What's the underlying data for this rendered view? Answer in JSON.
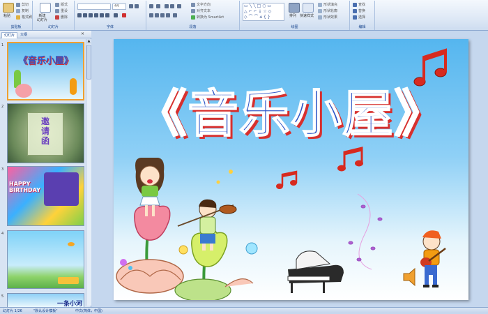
{
  "ribbon": {
    "clipboard": {
      "label": "剪贴板",
      "paste": "粘贴",
      "cut": "剪切",
      "copy": "复制",
      "format_painter": "格式刷"
    },
    "slides": {
      "label": "幻灯片",
      "new_slide": "新建\n幻灯片",
      "layout": "版式",
      "reset": "重设",
      "delete": "删除"
    },
    "font": {
      "label": "字体",
      "font_size": "44"
    },
    "paragraph": {
      "label": "段落",
      "text_direction": "文字方向",
      "align_text": "对齐文本",
      "smartart": "转换为 SmartArt"
    },
    "drawing": {
      "label": "绘图",
      "arrange": "排列",
      "quick_styles": "快速样式",
      "shape_fill": "形状填充",
      "shape_outline": "形状轮廓",
      "shape_effects": "形状效果"
    },
    "editing": {
      "label": "编辑",
      "find": "查找",
      "replace": "替换",
      "select": "选择"
    }
  },
  "panel": {
    "tab_slides": "幻灯片",
    "tab_outline": "大纲",
    "thumbnails": [
      {
        "num": "1",
        "title": "《音乐小屋》"
      },
      {
        "num": "2",
        "title": "邀请函"
      },
      {
        "num": "3",
        "title": "HAPPY BIRTHDAY"
      },
      {
        "num": "4",
        "title": ""
      },
      {
        "num": "5",
        "title": "一条小河"
      }
    ]
  },
  "slide": {
    "title": "《音乐小屋》"
  },
  "status": {
    "slide_count": "幻灯片 1/26",
    "theme": "\"默认设计模板\"",
    "language": "中文(简体，中国)"
  },
  "colors": {
    "ribbon_blue": "#15428b",
    "title_blue": "#2f57c8",
    "title_shadow": "#d7302e",
    "note_red": "#d72a1f"
  }
}
